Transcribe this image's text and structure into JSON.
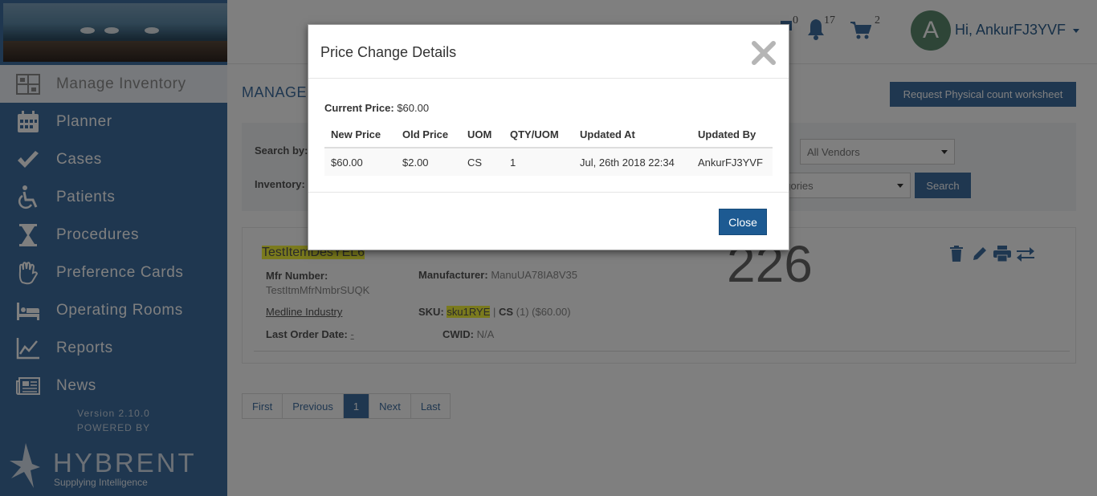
{
  "sidebar": {
    "items": [
      {
        "label": "Manage Inventory",
        "icon": "inventory-icon",
        "active": true
      },
      {
        "label": "Planner",
        "icon": "calendar-icon"
      },
      {
        "label": "Cases",
        "icon": "check-icon"
      },
      {
        "label": "Patients",
        "icon": "wheelchair-icon"
      },
      {
        "label": "Procedures",
        "icon": "hourglass-icon"
      },
      {
        "label": "Preference Cards",
        "icon": "hand-icon"
      },
      {
        "label": "Operating Rooms",
        "icon": "bed-icon"
      },
      {
        "label": "Reports",
        "icon": "chart-icon"
      },
      {
        "label": "News",
        "icon": "newspaper-icon"
      }
    ],
    "version": "Version 2.10.0",
    "powered_by": "POWERED BY",
    "logo_word": "HYBRENT",
    "logo_tagline": "Supplying Intelligence"
  },
  "topbar": {
    "messages_count": "0",
    "notifications_count": "17",
    "cart_count": "2",
    "avatar_letter": "A",
    "greeting": "Hi, AnkurFJ3YVF"
  },
  "main": {
    "title": "MANAGE I",
    "request_button": "Request Physical count worksheet",
    "search_by_label": "Search by:",
    "inventory_label": "Inventory:",
    "vendor_select": "All Vendors",
    "category_select": "egories",
    "search_button": "Search"
  },
  "item": {
    "name": "TestItemDesYEL6",
    "mfr_number_label": "Mfr Number:",
    "mfr_number": "TestItmMfrNmbrSUQK",
    "manufacturer_label": "Manufacturer:",
    "manufacturer": "ManuUA78IA8V35",
    "vendor": "Medline Industry",
    "sku_label": "SKU:",
    "sku": "sku1RYE",
    "uom": "CS",
    "uom_detail": "(1) ($60.00)",
    "last_order_label": "Last Order Date:",
    "last_order": "-",
    "cwid_label": "CWID:",
    "cwid": "N/A",
    "quantity": "226"
  },
  "pagination": [
    "First",
    "Previous",
    "1",
    "Next",
    "Last"
  ],
  "modal": {
    "title": "Price Change Details",
    "current_price_label": "Current Price:",
    "current_price": "$60.00",
    "columns": [
      "New Price",
      "Old Price",
      "UOM",
      "QTY/UOM",
      "Updated At",
      "Updated By"
    ],
    "rows": [
      [
        "$60.00",
        "$2.00",
        "CS",
        "1",
        "Jul, 26th 2018 22:34",
        "AnkurFJ3YVF"
      ]
    ],
    "close_button": "Close"
  },
  "colors": {
    "brand": "#3f6ea1",
    "modal_button": "#1d5a92",
    "highlight": "#f5f53b"
  }
}
